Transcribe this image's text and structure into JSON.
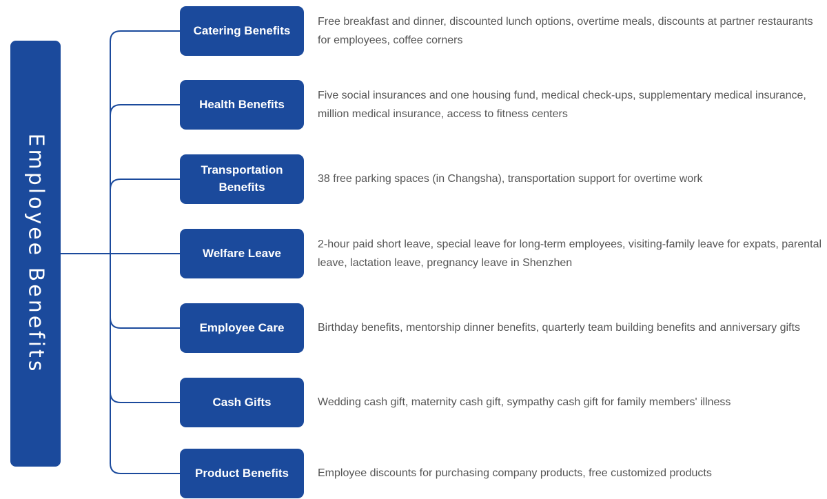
{
  "diagram": {
    "root": {
      "label": "Employee Benefits"
    },
    "branches": [
      {
        "label": "Catering Benefits",
        "description": "Free breakfast and dinner, discounted lunch options, overtime meals, discounts at partner restaurants for employees, coffee corners"
      },
      {
        "label": "Health Benefits",
        "description": "Five social insurances and one housing fund, medical check-ups, supplementary medical insurance, million medical insurance, access to fitness centers"
      },
      {
        "label": "Transportation Benefits",
        "description": "38 free parking spaces (in Changsha), transportation support for overtime work"
      },
      {
        "label": "Welfare Leave",
        "description": "2-hour paid short leave, special leave for long-term employees, visiting-family leave for expats, parental leave, lactation leave, pregnancy leave in Shenzhen"
      },
      {
        "label": "Employee Care",
        "description": "Birthday benefits, mentorship dinner benefits, quarterly team building benefits and anniversary gifts"
      },
      {
        "label": "Cash Gifts",
        "description": "Wedding cash gift, maternity cash gift, sympathy cash gift for family members' illness"
      },
      {
        "label": "Product Benefits",
        "description": "Employee discounts for purchasing company products, free customized products"
      }
    ]
  },
  "colors": {
    "box_fill": "#1b4a9c",
    "box_text": "#ffffff",
    "connector": "#1b4a9c",
    "description_text": "#555555",
    "background": "#ffffff"
  }
}
